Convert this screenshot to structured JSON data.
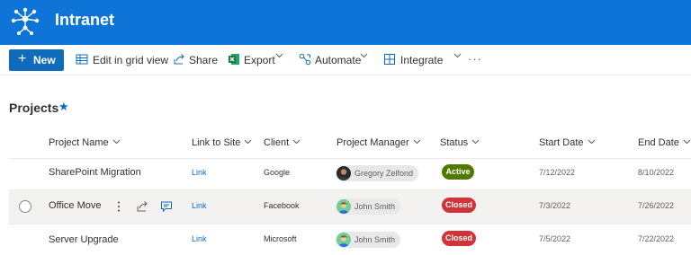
{
  "site": {
    "title": "Intranet"
  },
  "toolbar": {
    "new_label": "New",
    "edit_grid_label": "Edit in grid view",
    "share_label": "Share",
    "export_label": "Export",
    "automate_label": "Automate",
    "integrate_label": "Integrate",
    "more_label": "···"
  },
  "list": {
    "title": "Projects",
    "favorite_icon": "★",
    "columns": {
      "project_name": "Project Name",
      "link_to_site": "Link to Site",
      "client": "Client",
      "project_manager": "Project Manager",
      "status": "Status",
      "start_date": "Start Date",
      "end_date": "End Date"
    },
    "rows": [
      {
        "name": "SharePoint Migration",
        "link": "Link",
        "client": "Google",
        "manager": "Gregory Zelfond",
        "status": "Active",
        "start": "7/12/2022",
        "end": "8/10/2022"
      },
      {
        "name": "Office Move",
        "link": "Link",
        "client": "Facebook",
        "manager": "John Smith",
        "status": "Closed",
        "start": "7/3/2022",
        "end": "7/26/2022"
      },
      {
        "name": "Server Upgrade",
        "link": "Link",
        "client": "Microsoft",
        "manager": "John Smith",
        "status": "Closed",
        "start": "7/5/2022",
        "end": "7/22/2022"
      }
    ]
  },
  "colors": {
    "suite_bar": "#0f74d7",
    "accent": "#0f6cbd",
    "status_active": "#4f7a00",
    "status_closed": "#d13438"
  },
  "icons": {
    "logo": "intranet-network-logo",
    "new": "plus-icon",
    "edit_grid": "grid-icon",
    "share": "share-icon",
    "export": "excel-icon",
    "automate": "flow-icon",
    "integrate": "integrate-icon",
    "row_more": "vertical-ellipsis-icon",
    "row_share": "share-icon",
    "row_comment": "comment-icon"
  }
}
